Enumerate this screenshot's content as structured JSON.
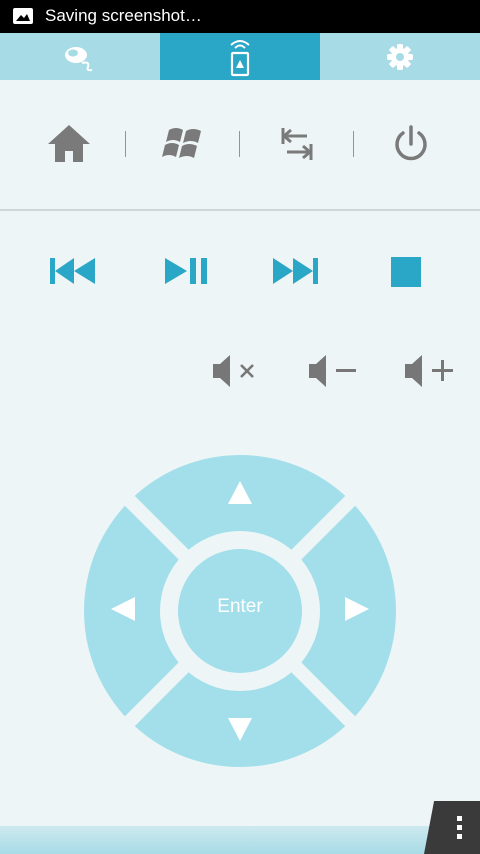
{
  "status_bar": {
    "notification_text": "Saving screenshot…",
    "icon": "image-icon"
  },
  "tabs": [
    {
      "icon": "mouse-keyboard-icon",
      "selected": false
    },
    {
      "icon": "remote-control-icon",
      "selected": true
    },
    {
      "icon": "gear-icon",
      "selected": false
    }
  ],
  "system_buttons": [
    "home-icon",
    "windows-logo-icon",
    "tab-switch-icon",
    "power-icon"
  ],
  "media_buttons": [
    "previous-track-icon",
    "play-pause-icon",
    "next-track-icon",
    "stop-icon"
  ],
  "volume_buttons": [
    "volume-mute-icon",
    "volume-down-icon",
    "volume-up-icon"
  ],
  "dpad": {
    "enter_label": "Enter",
    "arrows": [
      "up-arrow-icon",
      "left-arrow-icon",
      "right-arrow-icon",
      "down-arrow-icon"
    ]
  },
  "colors": {
    "accent": "#2aa6c6",
    "tab_bar": "#a7dbe6",
    "dpad": "#a2dfeb",
    "grey_icon": "#777777",
    "background": "#eef5f6"
  }
}
